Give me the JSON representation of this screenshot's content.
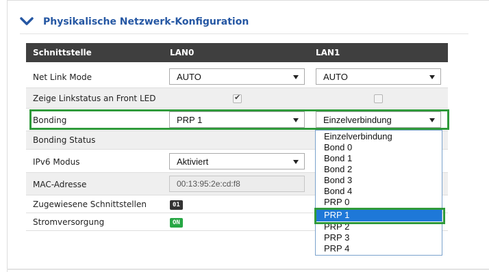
{
  "section": {
    "title": "Physikalische Netzwerk-Konfiguration",
    "icon": "chevron-down-icon"
  },
  "table": {
    "headers": {
      "interface": "Schnittstelle",
      "lan0": "LAN0",
      "lan1": "LAN1"
    },
    "net_link_mode": {
      "label": "Net Link Mode",
      "lan0": "AUTO",
      "lan1": "AUTO"
    },
    "front_led": {
      "label": "Zeige Linkstatus an Front LED",
      "lan0_checked": true,
      "lan1_checked": false
    },
    "bonding": {
      "label": "Bonding",
      "lan0": "PRP 1",
      "lan1": "Einzelverbindung"
    },
    "bonding_status": {
      "label": "Bonding Status"
    },
    "ipv6": {
      "label": "IPv6 Modus",
      "lan0": "Aktiviert"
    },
    "mac": {
      "label": "MAC-Adresse",
      "lan0": "00:13:95:2e:cd:f8"
    },
    "assigned": {
      "label": "Zugewiesene Schnittstellen",
      "lan0_badge": "01"
    },
    "power": {
      "label": "Stromversorgung",
      "lan0_badge": "ON"
    }
  },
  "dropdown": {
    "options": [
      "Einzelverbindung",
      "Bond 0",
      "Bond 1",
      "Bond 2",
      "Bond 3",
      "Bond 4",
      "PRP 0",
      "PRP 1",
      "PRP 2",
      "PRP 3",
      "PRP 4"
    ],
    "highlighted_index": 7
  },
  "colors": {
    "accent": "#2557a3",
    "highlight_box": "#2f9a3a",
    "selection": "#1e78d8",
    "header_bg": "#3f3f3f",
    "badge_on": "#27a744"
  }
}
